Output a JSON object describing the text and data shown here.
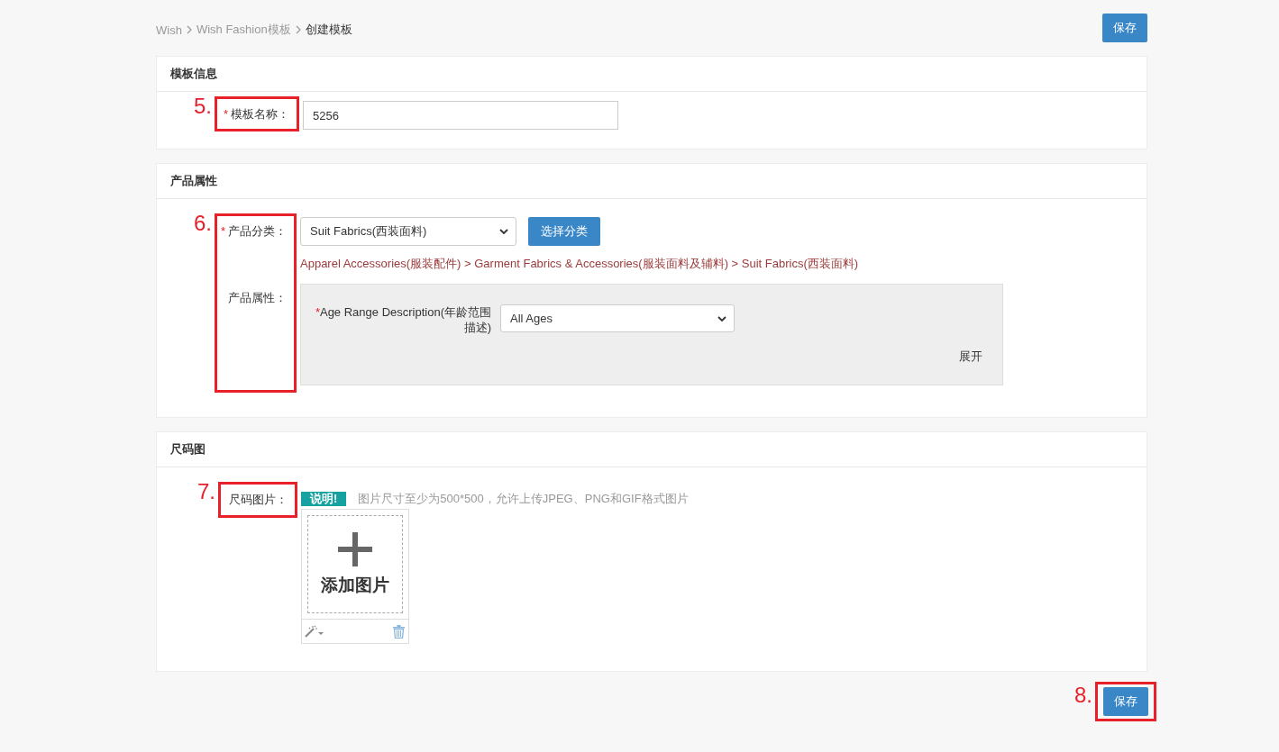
{
  "breadcrumb": [
    {
      "label": "Wish",
      "current": false
    },
    {
      "label": "Wish Fashion模板",
      "current": false
    },
    {
      "label": "创建模板",
      "current": true
    }
  ],
  "top_save_button": "保存",
  "sections": [
    {
      "kind": "name",
      "title": "模板信息",
      "annotation": "5.",
      "field": {
        "required_mark": "*",
        "label": "模板名称：",
        "value": "5256"
      }
    },
    {
      "kind": "category",
      "title": "产品属性",
      "annotation": "6.",
      "category": {
        "required_mark": "*",
        "label": "产品分类：",
        "value": "Suit Fabrics(西装面料)",
        "button": "选择分类",
        "path": "Apparel Accessories(服装配件) > Garment Fabrics & Accessories(服装面料及辅料) > Suit Fabrics(西装面料)"
      },
      "attributes": {
        "label": "产品属性：",
        "items": [
          {
            "required_mark": "*",
            "label": "Age Range Description(年龄范围描述)",
            "value": "All Ages"
          }
        ],
        "toggle": "展开"
      }
    },
    {
      "kind": "image",
      "title": "尺码图",
      "annotation": "7.",
      "field": {
        "label": "尺码图片：",
        "badge": "说明!",
        "hint": "图片尺寸至少为500*500，允许上传JPEG、PNG和GIF格式图片",
        "upload_label": "添加图片"
      }
    }
  ],
  "bottom_save": {
    "label": "保存",
    "annotation": "8."
  }
}
